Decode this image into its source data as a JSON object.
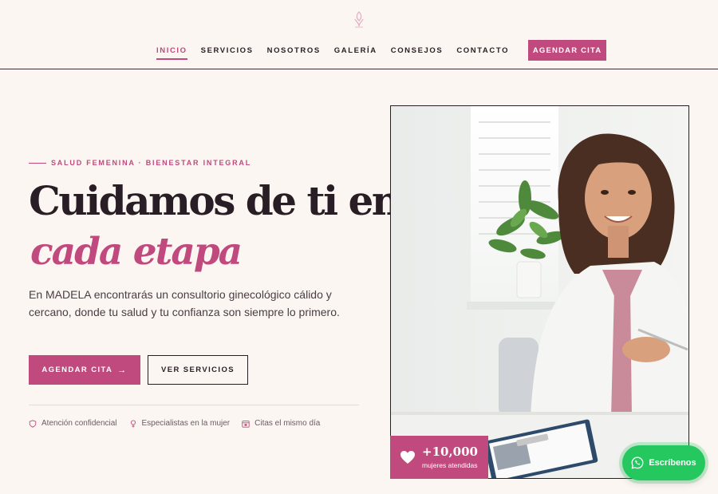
{
  "brand": {
    "accent": "#c04a7d",
    "dark": "#2a1e26",
    "background": "#fbf6f1",
    "whatsapp_green": "#25c85e"
  },
  "header": {
    "logo_icon": "madela-logo-icon",
    "nav": [
      {
        "label": "INICIO",
        "active": true
      },
      {
        "label": "SERVICIOS",
        "active": false
      },
      {
        "label": "NOSOTROS",
        "active": false
      },
      {
        "label": "GALERÍA",
        "active": false
      },
      {
        "label": "CONSEJOS",
        "active": false
      },
      {
        "label": "CONTACTO",
        "active": false
      }
    ],
    "cta_label": "AGENDAR CITA"
  },
  "hero": {
    "eyebrow": "SALUD FEMENINA · BIENESTAR INTEGRAL",
    "headline_line1": "Cuidamos de ti en",
    "headline_line2": "cada etapa",
    "lead": "En MADELA encontrarás un consultorio ginecológico cálido y cercano, donde tu salud y tu confianza son siempre lo primero.",
    "primary_button": "AGENDAR CITA",
    "primary_button_icon": "arrow-right-icon",
    "secondary_button": "VER SERVICIOS",
    "features": [
      {
        "icon": "shield-icon",
        "label": "Atención confidencial"
      },
      {
        "icon": "female-symbol-icon",
        "label": "Especialistas en la mujer"
      },
      {
        "icon": "calendar-icon",
        "label": "Citas el mismo día"
      }
    ]
  },
  "image_card": {
    "stat_icon": "heart-icon",
    "stat_number": "+10,000",
    "stat_label": "mujeres atendidas"
  },
  "whatsapp": {
    "label": "Escríbenos",
    "icon": "whatsapp-icon"
  }
}
